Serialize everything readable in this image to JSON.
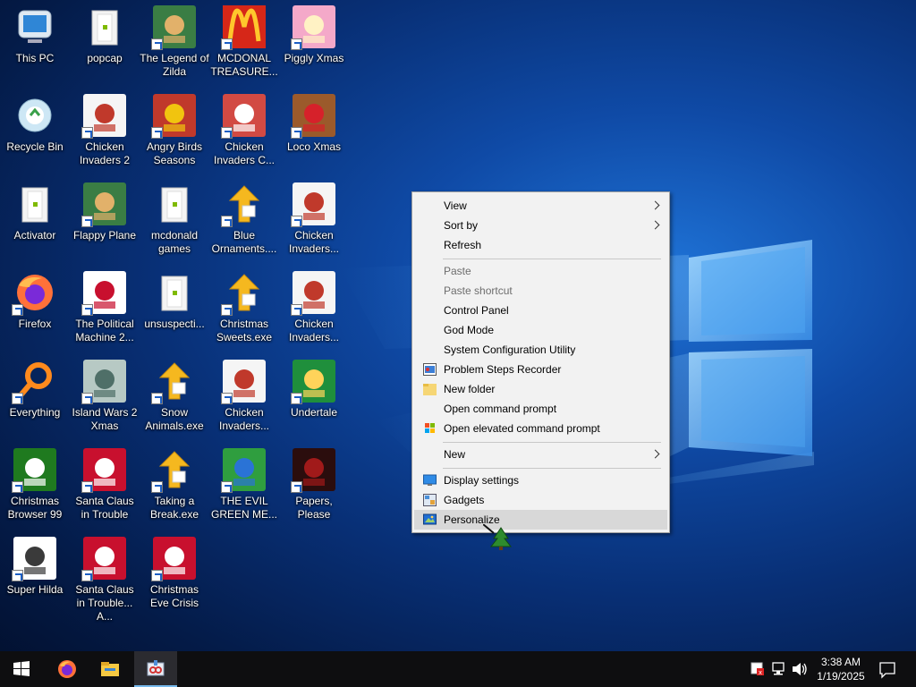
{
  "desktop": {
    "icons": [
      {
        "label": "This PC",
        "icon": "monitor-icon"
      },
      {
        "label": "popcap",
        "icon": "folder-icon"
      },
      {
        "label": "The Legend of Zilda",
        "icon": "game-icon"
      },
      {
        "label": "MCDONAL TREASURE...",
        "icon": "mcdonalds-icon"
      },
      {
        "label": "Piggly Xmas",
        "icon": "pig-icon"
      },
      {
        "label": "Recycle Bin",
        "icon": "recycle-bin-icon"
      },
      {
        "label": "Chicken Invaders 2",
        "icon": "chicken-icon"
      },
      {
        "label": "Angry Birds Seasons",
        "icon": "angry-birds-icon"
      },
      {
        "label": "Chicken Invaders C...",
        "icon": "snowman-icon"
      },
      {
        "label": "Loco Xmas",
        "icon": "bear-icon"
      },
      {
        "label": "Activator",
        "icon": "file-icon"
      },
      {
        "label": "Flappy Plane",
        "icon": "game-icon"
      },
      {
        "label": "mcdonald games",
        "icon": "file-icon"
      },
      {
        "label": "Blue Ornaments....",
        "icon": "puzzle-icon"
      },
      {
        "label": "Chicken Invaders...",
        "icon": "chicken-icon"
      },
      {
        "label": "Firefox",
        "icon": "firefox-icon"
      },
      {
        "label": "The Political Machine 2...",
        "icon": "political-icon"
      },
      {
        "label": "unsuspecti...",
        "icon": "file-icon"
      },
      {
        "label": "Christmas Sweets.exe",
        "icon": "puzzle-icon"
      },
      {
        "label": "Chicken Invaders...",
        "icon": "chicken-icon"
      },
      {
        "label": "Everything",
        "icon": "search-icon"
      },
      {
        "label": "Island Wars 2 Xmas",
        "icon": "island-icon"
      },
      {
        "label": "Snow Animals.exe",
        "icon": "puzzle-icon"
      },
      {
        "label": "Chicken Invaders...",
        "icon": "chicken-icon"
      },
      {
        "label": "Undertale",
        "icon": "undertale-icon"
      },
      {
        "label": "Christmas Browser 99",
        "icon": "tree-icon"
      },
      {
        "label": "Santa Claus in Trouble",
        "icon": "santa-icon"
      },
      {
        "label": "Taking a Break.exe",
        "icon": "puzzle-icon"
      },
      {
        "label": "THE EVIL GREEN ME...",
        "icon": "messenger-icon"
      },
      {
        "label": "Papers, Please",
        "icon": "papers-please-icon"
      },
      {
        "label": "Super Hilda",
        "icon": "pixel-icon"
      },
      {
        "label": "Santa Claus in Trouble... A...",
        "icon": "santa-icon"
      },
      {
        "label": "Christmas Eve Crisis",
        "icon": "santa-icon"
      }
    ]
  },
  "context_menu": {
    "view": "View",
    "sort_by": "Sort by",
    "refresh": "Refresh",
    "paste": "Paste",
    "paste_shortcut": "Paste shortcut",
    "control_panel": "Control Panel",
    "god_mode": "God Mode",
    "system_config": "System Configuration Utility",
    "problem_steps": "Problem Steps Recorder",
    "new_folder": "New folder",
    "open_cmd": "Open command prompt",
    "open_elevated_cmd": "Open elevated command prompt",
    "new": "New",
    "display_settings": "Display settings",
    "gadgets": "Gadgets",
    "personalize": "Personalize"
  },
  "taskbar": {
    "time": "3:38 AM",
    "date": "1/19/2025",
    "pinned": [
      "windows-start-icon",
      "firefox-icon",
      "file-explorer-icon",
      "snipping-tool-icon"
    ]
  },
  "colors": {
    "menu_bg": "#f2f2f2",
    "menu_hover": "#d8d8d8",
    "taskbar_bg": "#0e0e10",
    "accent": "#76b9ed"
  }
}
